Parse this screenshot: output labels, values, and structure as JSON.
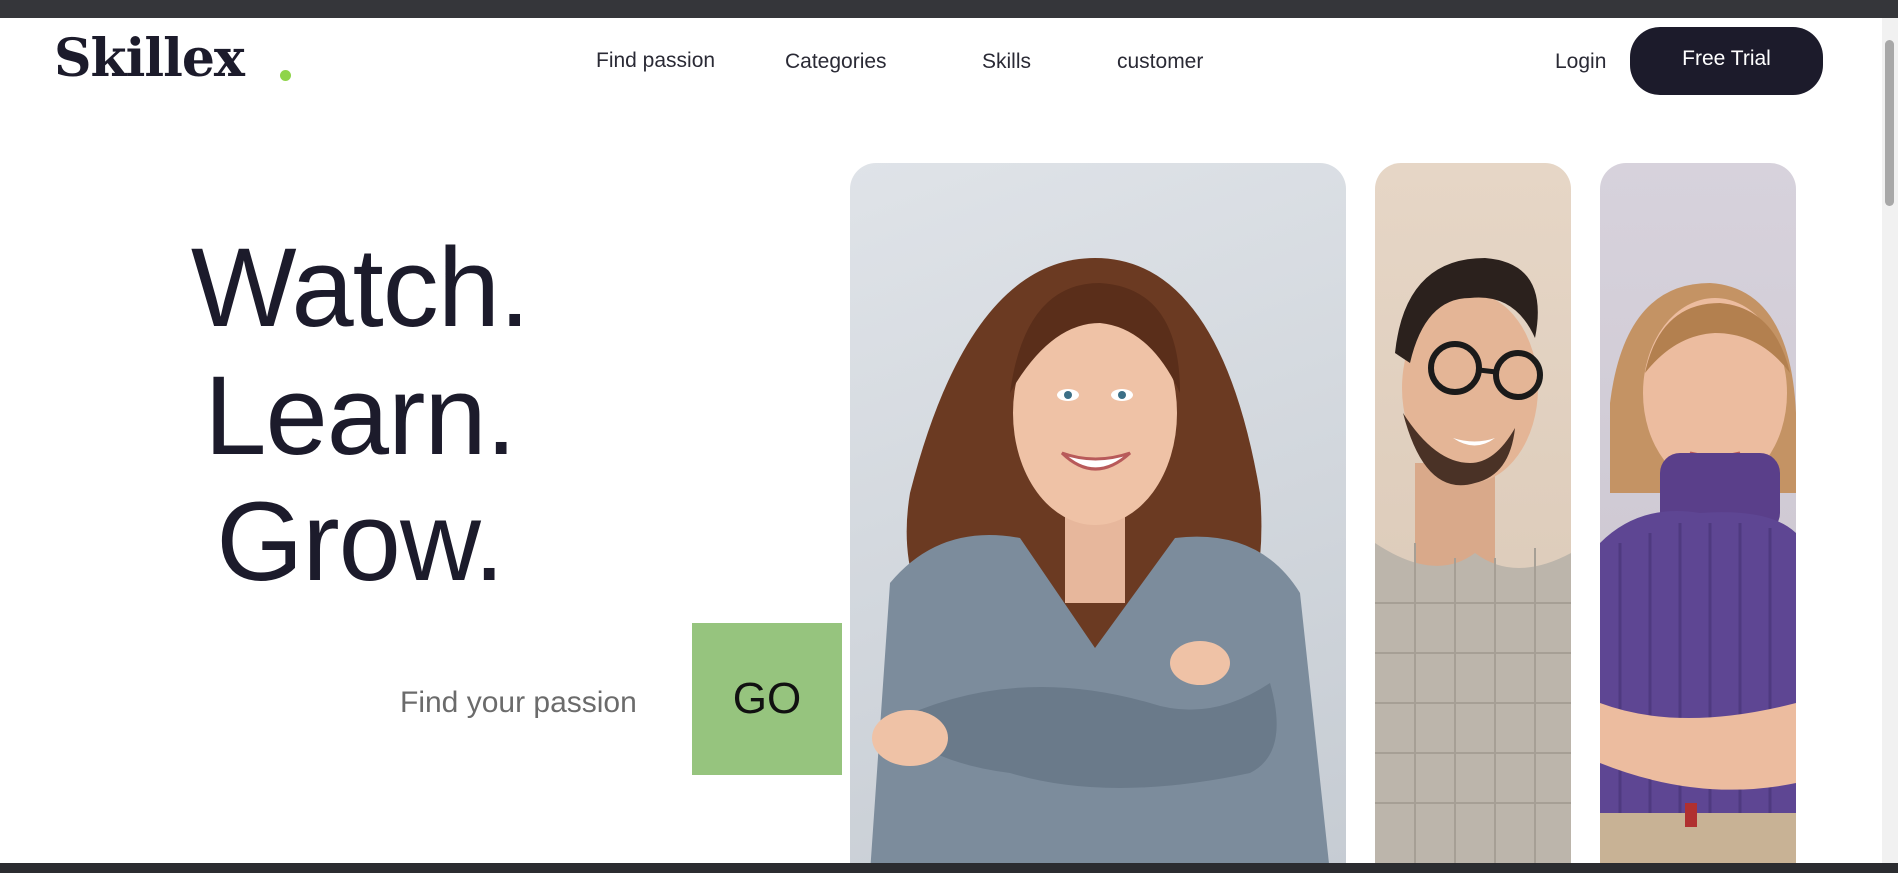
{
  "brand": {
    "name": "Skillex",
    "dot_color": "#8fd44a"
  },
  "nav": {
    "links": [
      "Find passion",
      "Categories",
      "Skills",
      "customer"
    ],
    "login": "Login",
    "cta": "Free Trial"
  },
  "hero": {
    "lines": [
      "Watch.",
      "Learn.",
      "Grow."
    ],
    "search_placeholder": "Find your passion",
    "go_label": "GO"
  },
  "images": [
    {
      "icon": "woman-grey-sweater-portrait"
    },
    {
      "icon": "man-glasses-portrait"
    },
    {
      "icon": "woman-purple-sweater-portrait"
    }
  ],
  "colors": {
    "primary": "#1c1b2b",
    "accent": "#96c47e",
    "dot": "#8fd44a"
  }
}
